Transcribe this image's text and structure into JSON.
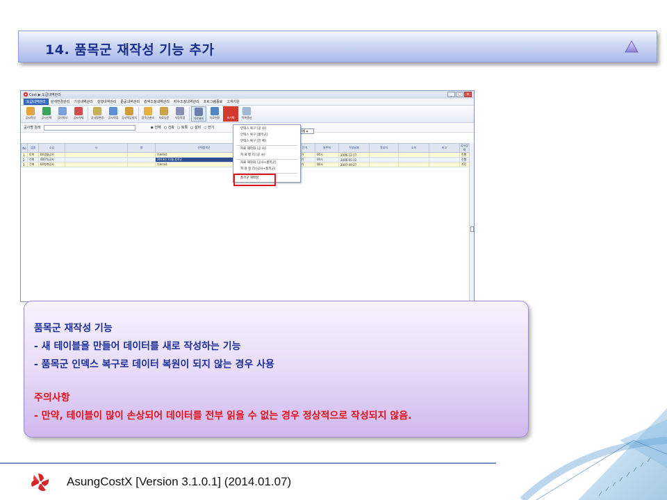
{
  "slide": {
    "title": "14. 품목군 재작성 기능 추가"
  },
  "app": {
    "window_title": "Cost ▶ 도급내역관리",
    "menu": [
      "도급내역관리",
      "설계변경관리",
      "기성내역관리",
      "실행내역관리",
      "준공내역관리",
      "총액조정내역관리",
      "자수조정내역관리",
      "프로그램종료",
      "고객지원"
    ],
    "toolbar": [
      "공사작성",
      "공사선택",
      "공사복사",
      "공사삭제",
      "공사명변경",
      "공사백업",
      "공사백업설치",
      "품목군관리",
      "자료다운",
      "자동복합",
      "자료관리",
      "자료변환",
      "초기화",
      "목록갱신"
    ],
    "search_label": "공사명 검색",
    "radio_options": [
      "전체",
      "건축",
      "토목",
      "설비",
      "전기"
    ],
    "filter_value": "전체",
    "grid": {
      "headers": [
        "No",
        "업종",
        "소공",
        "사",
        "명",
        "선택품목군",
        "",
        "단가",
        "발주처",
        "작성날짜",
        "작성자",
        "소속",
        "비고",
        "공사상태"
      ],
      "rows": [
        {
          "no": "1",
          "type": "토목",
          "name": "00생흘공사",
          "group": "기초자료",
          "price": "전단가",
          "client": "00시",
          "date": "2006-12-17",
          "status": "진행"
        },
        {
          "no": "2",
          "type": "건축",
          "name": "00단독공사",
          "group": "2013년 11월 품목군",
          "price": "전단가",
          "client": "00시",
          "date": "2006-05-12",
          "status": "진행"
        },
        {
          "no": "3",
          "type": "건축",
          "name": "00청축공사",
          "group": "기초자료",
          "price": "전단가",
          "client": "00시",
          "date": "2007-09-27",
          "status": "가진"
        }
      ]
    },
    "dropdown": {
      "items": [
        "인덱스 복구 [공 사]",
        "인덱스 복구 [품목군]",
        "인덱스 복구 [전 체]",
        "자료 재작화 [공 사]",
        "자 료 정 리 [공 사]",
        "자료 재작화 [공사+품목군]",
        "자 료 정 리 [공사+품목군]",
        "품목군 재작성"
      ]
    }
  },
  "note": {
    "heading": "품목군 재작성 기능",
    "line1": " - 새 테이블을 만들어 데이터를 새로 작성하는 기능",
    "line2": " - 품목군 인덱스 복구로 데이터 복원이 되지 않는 경우 사용",
    "caution_heading": "주의사항",
    "caution_line": " - 만약, 테이블이 많이 손상되어 데이터를 전부 읽을 수 없는 경우 정상적으로 작성되지 않음."
  },
  "footer": {
    "text": "AsungCostX   [Version 3.1.0.1]    (2014.01.07)"
  },
  "colors": {
    "title_text": "#1a2f8c",
    "note_blue": "#1b2f9a",
    "note_red": "#e0121a",
    "highlight": "#e0141a"
  }
}
